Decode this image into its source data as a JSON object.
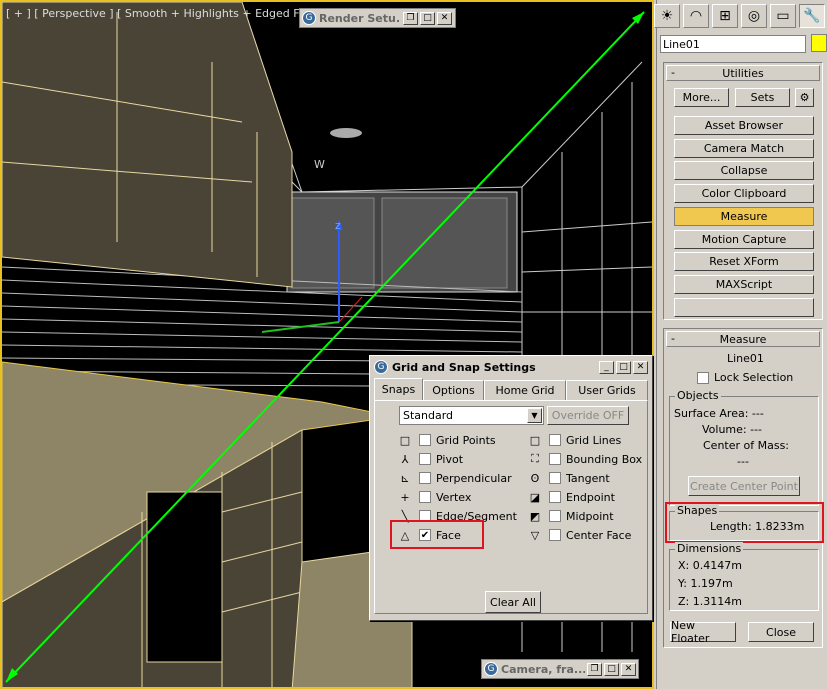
{
  "viewport": {
    "label": "[ + ] [ Perspective ] [ Smooth + Highlights + Edged Faces ]",
    "axis_label": "W",
    "axis_z": "z"
  },
  "render_setup_window": {
    "title": "Render Setu..."
  },
  "camera_window": {
    "title": "Camera, fra..."
  },
  "grid_snap": {
    "title": "Grid and Snap Settings",
    "tabs": [
      "Snaps",
      "Options",
      "Home Grid",
      "User Grids"
    ],
    "preset": "Standard",
    "override_label": "Override OFF",
    "snaps_left": [
      {
        "label": "Grid Points",
        "checked": false
      },
      {
        "label": "Pivot",
        "checked": false
      },
      {
        "label": "Perpendicular",
        "checked": false
      },
      {
        "label": "Vertex",
        "checked": false
      },
      {
        "label": "Edge/Segment",
        "checked": false
      },
      {
        "label": "Face",
        "checked": true
      }
    ],
    "snaps_right": [
      {
        "label": "Grid Lines",
        "checked": false
      },
      {
        "label": "Bounding Box",
        "checked": false
      },
      {
        "label": "Tangent",
        "checked": false
      },
      {
        "label": "Endpoint",
        "checked": false
      },
      {
        "label": "Midpoint",
        "checked": false
      },
      {
        "label": "Center Face",
        "checked": false
      }
    ],
    "clear_all": "Clear All"
  },
  "command_panel": {
    "object_name": "Line01",
    "object_color": "#ffff00",
    "utilities": {
      "header": "Utilities",
      "more": "More...",
      "sets": "Sets",
      "items": [
        "Asset Browser",
        "Camera Match",
        "Collapse",
        "Color Clipboard",
        "Measure",
        "Motion Capture",
        "Reset XForm",
        "MAXScript"
      ],
      "active_item": "Measure"
    },
    "measure": {
      "header": "Measure",
      "object": "Line01",
      "lock_selection": "Lock Selection",
      "objects_group": "Objects",
      "surface_area": "Surface Area: ---",
      "volume": "Volume: ---",
      "center_of_mass": "Center of Mass:",
      "center_value": "---",
      "create_center_point": "Create Center Point",
      "shapes_group": "Shapes",
      "length": "Length:  1.8233m",
      "dimensions_group": "Dimensions",
      "dim_x": "X:  0.4147m",
      "dim_y": "Y:  1.197m",
      "dim_z": "Z:  1.3114m",
      "new_floater": "New Floater",
      "close": "Close"
    },
    "highlight_color": "#e0141e"
  }
}
